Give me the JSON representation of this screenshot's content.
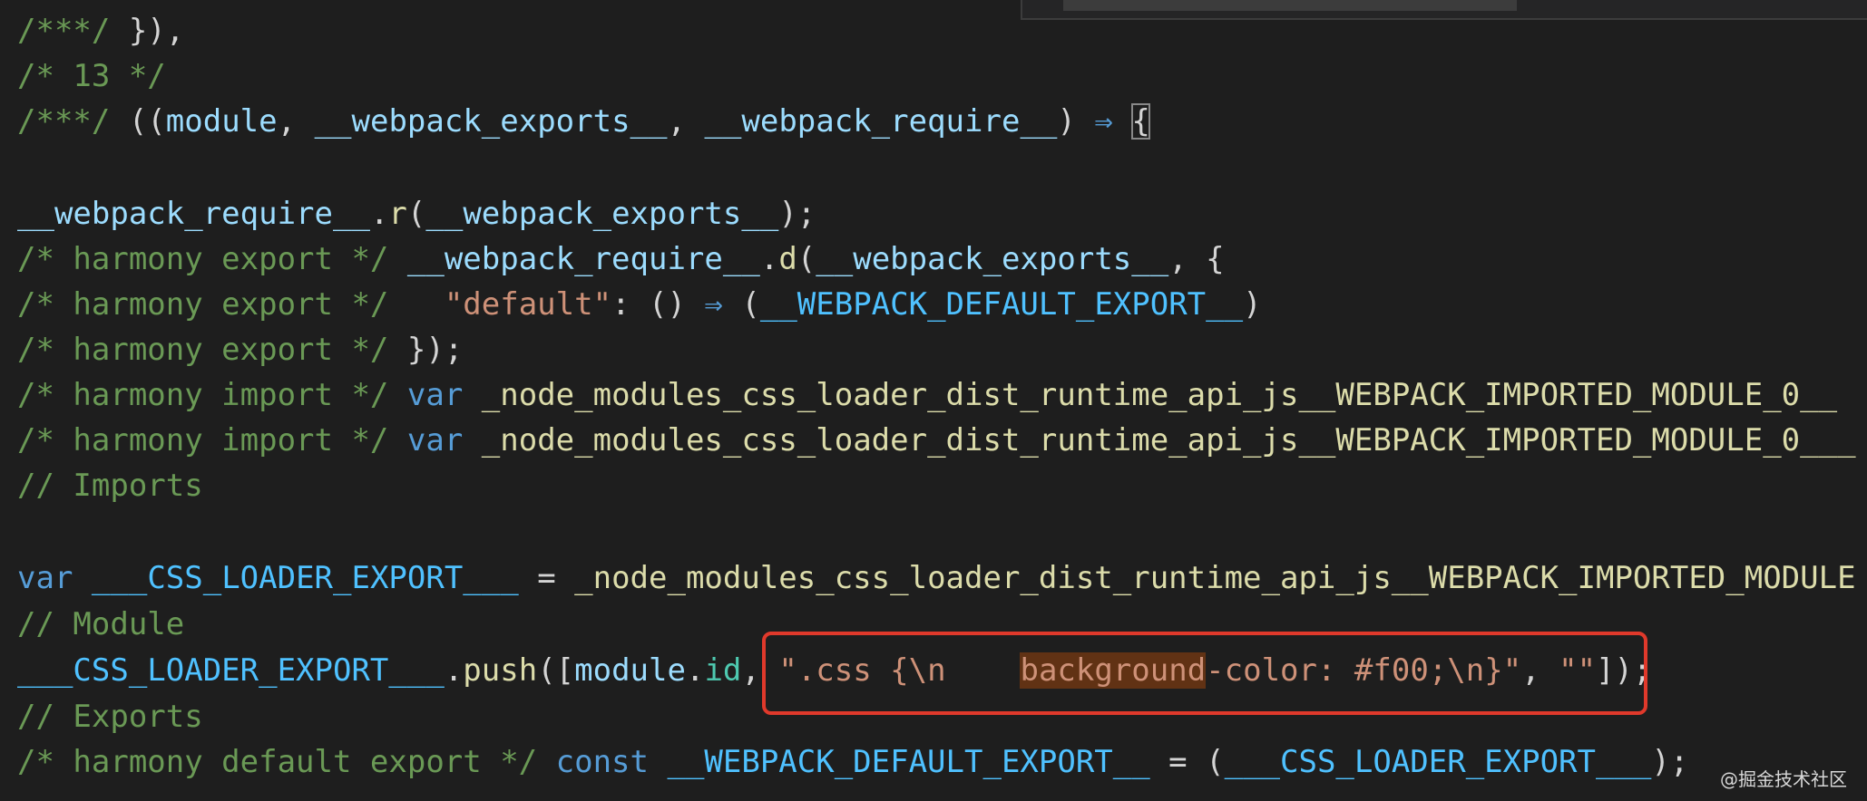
{
  "colors": {
    "background": "#1e1e1e",
    "comment": "#6a9955",
    "variable": "#9cdcfe",
    "function": "#dcdcaa",
    "keyword": "#569cd6",
    "string": "#ce9178",
    "constant": "#4fc1ff",
    "highlight_box": "#e0392b",
    "selection": "#613214"
  },
  "code": {
    "l1": {
      "a": "/***/",
      "b": " }),"
    },
    "l2": {
      "a": "/* 13 */"
    },
    "l3": {
      "a": "/***/",
      "b": " ((",
      "c": "module",
      "d": ", ",
      "e": "__webpack_exports__",
      "f": ", ",
      "g": "__webpack_require__",
      "h": ") ",
      "i": "⇒",
      "j": " ",
      "k": "{"
    },
    "l5": {
      "a": "__webpack_require__",
      "b": ".",
      "c": "r",
      "d": "(",
      "e": "__webpack_exports__",
      "f": ");"
    },
    "l6": {
      "a": "/* harmony export */",
      "b": " ",
      "c": "__webpack_require__",
      "d": ".",
      "e": "d",
      "f": "(",
      "g": "__webpack_exports__",
      "h": ", {"
    },
    "l7": {
      "a": "/* harmony export */",
      "b": "   ",
      "c": "\"default\"",
      "d": ": () ",
      "e": "⇒",
      "f": " (",
      "g": "__WEBPACK_DEFAULT_EXPORT__",
      "h": ")"
    },
    "l8": {
      "a": "/* harmony export */",
      "b": " });"
    },
    "l9": {
      "a": "/* harmony import */",
      "b": " ",
      "c": "var",
      "d": " ",
      "e": "_node_modules_css_loader_dist_runtime_api_js__WEBPACK_IMPORTED_MODULE_0__"
    },
    "l10": {
      "a": "/* harmony import */",
      "b": " ",
      "c": "var",
      "d": " ",
      "e": "_node_modules_css_loader_dist_runtime_api_js__WEBPACK_IMPORTED_MODULE_0___"
    },
    "l11": {
      "a": "// Imports"
    },
    "l13": {
      "a": "var",
      "b": " ",
      "c": "___CSS_LOADER_EXPORT___",
      "d": " = ",
      "e": "_node_modules_css_loader_dist_runtime_api_js__WEBPACK_IMPORTED_MODULE"
    },
    "l14": {
      "a": "// Module"
    },
    "l15": {
      "a": "___CSS_LOADER_EXPORT___",
      "b": ".",
      "c": "push",
      "d": "([",
      "e": "module",
      "f": ".",
      "g": "id",
      "h": ", ",
      "i": "\".css {\\n    ",
      "j": "background",
      "k": "-color: #f00;\\n}\"",
      "l": ", ",
      "m": "\"\"",
      "n": "]);"
    },
    "l16": {
      "a": "// Exports"
    },
    "l17": {
      "a": "/* harmony default export */",
      "b": " ",
      "c": "const",
      "d": " ",
      "e": "__WEBPACK_DEFAULT_EXPORT__",
      "f": " = (",
      "g": "___CSS_LOADER_EXPORT___",
      "h": ");"
    }
  },
  "watermark": "@掘金技术社区"
}
